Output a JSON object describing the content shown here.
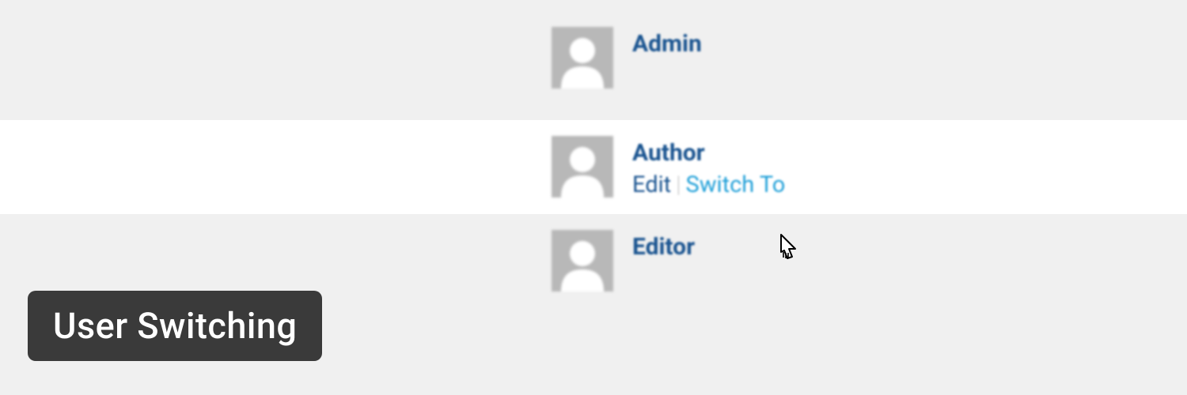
{
  "users": [
    {
      "name": "Admin"
    },
    {
      "name": "Author",
      "actions": {
        "edit": "Edit",
        "separator": "|",
        "switch_to": "Switch To"
      }
    },
    {
      "name": "Editor"
    }
  ],
  "banner": {
    "title": "User Switching"
  }
}
